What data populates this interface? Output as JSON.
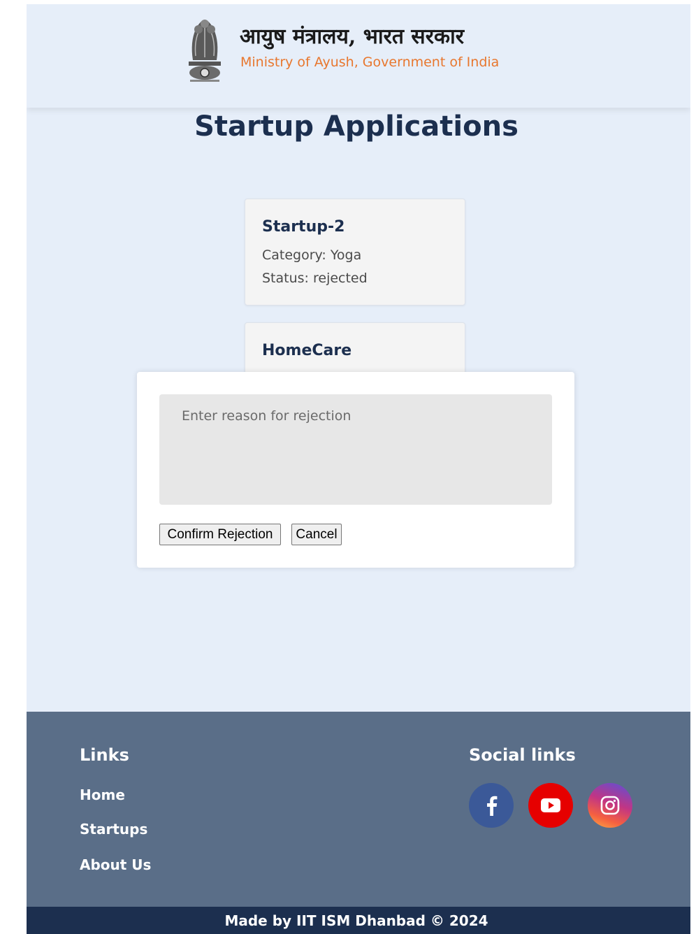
{
  "header": {
    "org_name_hindi": "आयुष मंत्रालय, भारत सरकार",
    "org_name_english": "Ministry of Ayush, Government of India",
    "emblem_icon": "national-emblem-icon"
  },
  "main": {
    "page_title": "Startup Applications",
    "startups": [
      {
        "name": "Startup-2",
        "category": "Category: Yoga",
        "status": "Status: rejected"
      },
      {
        "name": "HomeCare"
      }
    ]
  },
  "rejection_modal": {
    "reason_placeholder": "Enter reason for rejection",
    "reason_value": "",
    "confirm_label": "Confirm Rejection",
    "cancel_label": "Cancel"
  },
  "footer": {
    "links_heading": "Links",
    "links": [
      "Home",
      "Startups",
      "About Us"
    ],
    "social_heading": "Social links",
    "social": [
      {
        "icon": "facebook-icon",
        "color": "#3b5998"
      },
      {
        "icon": "youtube-icon",
        "color": "#e60000"
      },
      {
        "icon": "instagram-icon",
        "color": "#c13584"
      }
    ],
    "copyright": "Made by IIT ISM Dhanbad © 2024"
  },
  "colors": {
    "page_background": "#e6eef9",
    "title": "#1c2f4f",
    "accent_orange": "#e8772e",
    "footer": "#5a6e88",
    "copyright_bar": "#1c2f4f"
  }
}
